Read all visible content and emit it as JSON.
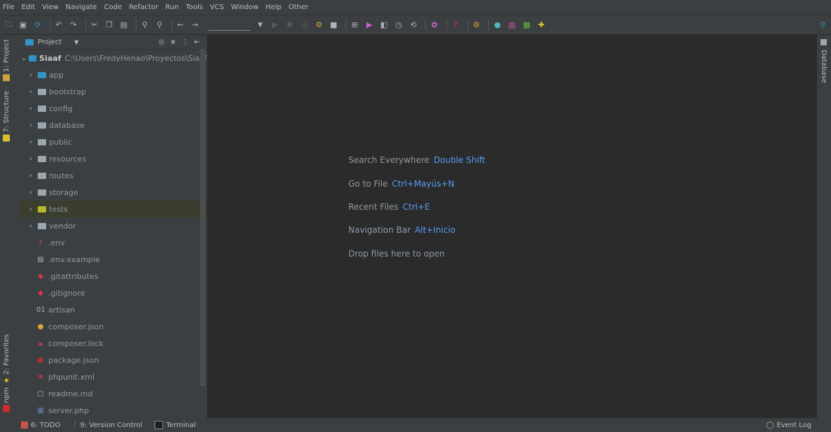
{
  "menu": [
    "File",
    "Edit",
    "View",
    "Navigate",
    "Code",
    "Refactor",
    "Run",
    "Tools",
    "VCS",
    "Window",
    "Help",
    "Other"
  ],
  "left_tabs": {
    "project": "1: Project",
    "structure": "7: Structure",
    "favorites": "2: Favorites",
    "npm": "npm"
  },
  "right_tabs": {
    "database": "Database"
  },
  "panel": {
    "title": "Project"
  },
  "root": {
    "name": "Siaaf",
    "path": "C:\\Users\\FredyHenao\\Proyectos\\Siaaf"
  },
  "tree": [
    {
      "label": "app",
      "type": "folder-blue"
    },
    {
      "label": "bootstrap",
      "type": "folder"
    },
    {
      "label": "config",
      "type": "folder"
    },
    {
      "label": "database",
      "type": "folder"
    },
    {
      "label": "public",
      "type": "folder"
    },
    {
      "label": "resources",
      "type": "folder"
    },
    {
      "label": "routes",
      "type": "folder"
    },
    {
      "label": "storage",
      "type": "folder"
    },
    {
      "label": "tests",
      "type": "folder-green"
    },
    {
      "label": "vendor",
      "type": "folder"
    },
    {
      "label": ".env",
      "type": "env-icon"
    },
    {
      "label": ".env.example",
      "type": "text-file-icon"
    },
    {
      "label": ".gitattributes",
      "type": "git-icon"
    },
    {
      "label": ".gitignore",
      "type": "git-icon"
    },
    {
      "label": "artisan",
      "type": "binary-icon"
    },
    {
      "label": "composer.json",
      "type": "composer-icon"
    },
    {
      "label": "composer.lock",
      "type": "lock-icon"
    },
    {
      "label": "package.json",
      "type": "npm-icon"
    },
    {
      "label": "phpunit.xml",
      "type": "xml-icon"
    },
    {
      "label": "readme.md",
      "type": "markdown-icon"
    },
    {
      "label": "server.php",
      "type": "php-icon"
    }
  ],
  "hints": [
    {
      "text": "Search Everywhere",
      "key": "Double Shift"
    },
    {
      "text": "Go to File",
      "key": "Ctrl+Mayús+N"
    },
    {
      "text": "Recent Files",
      "key": "Ctrl+E"
    },
    {
      "text": "Navigation Bar",
      "key": "Alt+Inicio"
    },
    {
      "text": "Drop files here to open",
      "key": ""
    }
  ],
  "status": {
    "todo": "6: TODO",
    "vcs": "9: Version Control",
    "terminal": "Terminal",
    "event_log": "Event Log"
  },
  "colors": {
    "accent": "#589df6",
    "panel": "#3c3f41",
    "editor": "#2b2b2b",
    "selection": "#3b3e2e"
  }
}
